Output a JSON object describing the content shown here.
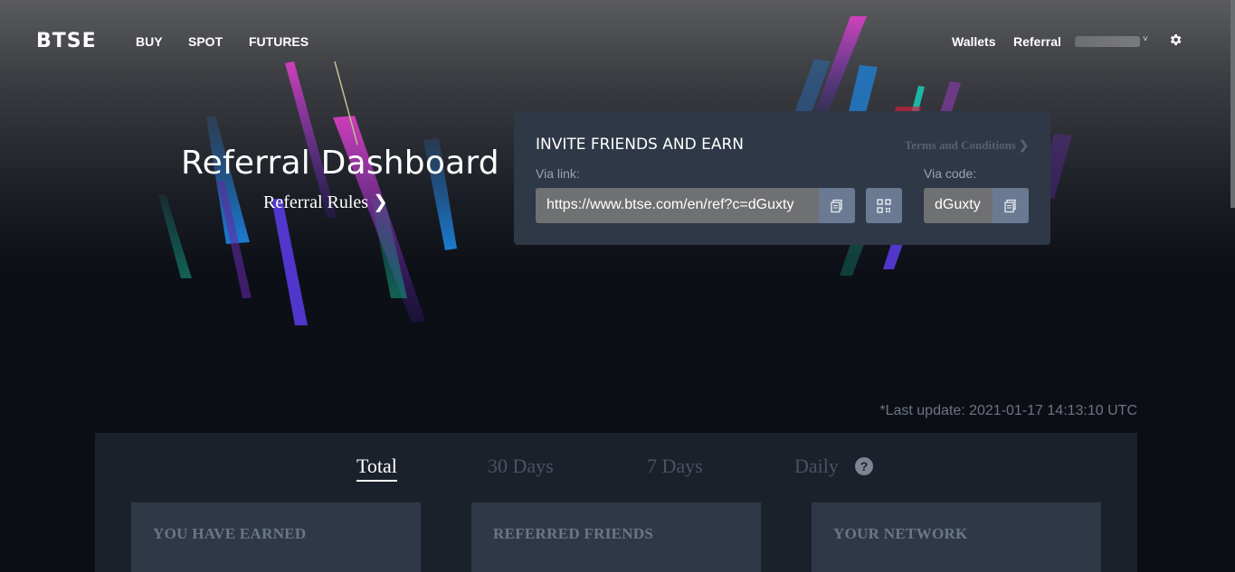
{
  "nav": {
    "logo": "BTSE",
    "links": [
      "BUY",
      "SPOT",
      "FUTURES"
    ],
    "right_links": [
      "Wallets",
      "Referral"
    ],
    "user_caret": "˅"
  },
  "hero": {
    "title": "Referral Dashboard",
    "rules": "Referral Rules ❯"
  },
  "invite": {
    "title": "INVITE FRIENDS AND EARN",
    "terms": "Terms and Conditions ❯",
    "via_link_label": "Via link:",
    "via_code_label": "Via code:",
    "link": "https://www.btse.com/en/ref?c=dGuxty",
    "code": "dGuxty"
  },
  "last_update": "*Last update: 2021-01-17 14:13:10 UTC",
  "tabs": [
    "Total",
    "30 Days",
    "7 Days",
    "Daily"
  ],
  "help_glyph": "?",
  "cards": [
    "YOU HAVE EARNED",
    "REFERRED FRIENDS",
    "YOUR NETWORK"
  ]
}
